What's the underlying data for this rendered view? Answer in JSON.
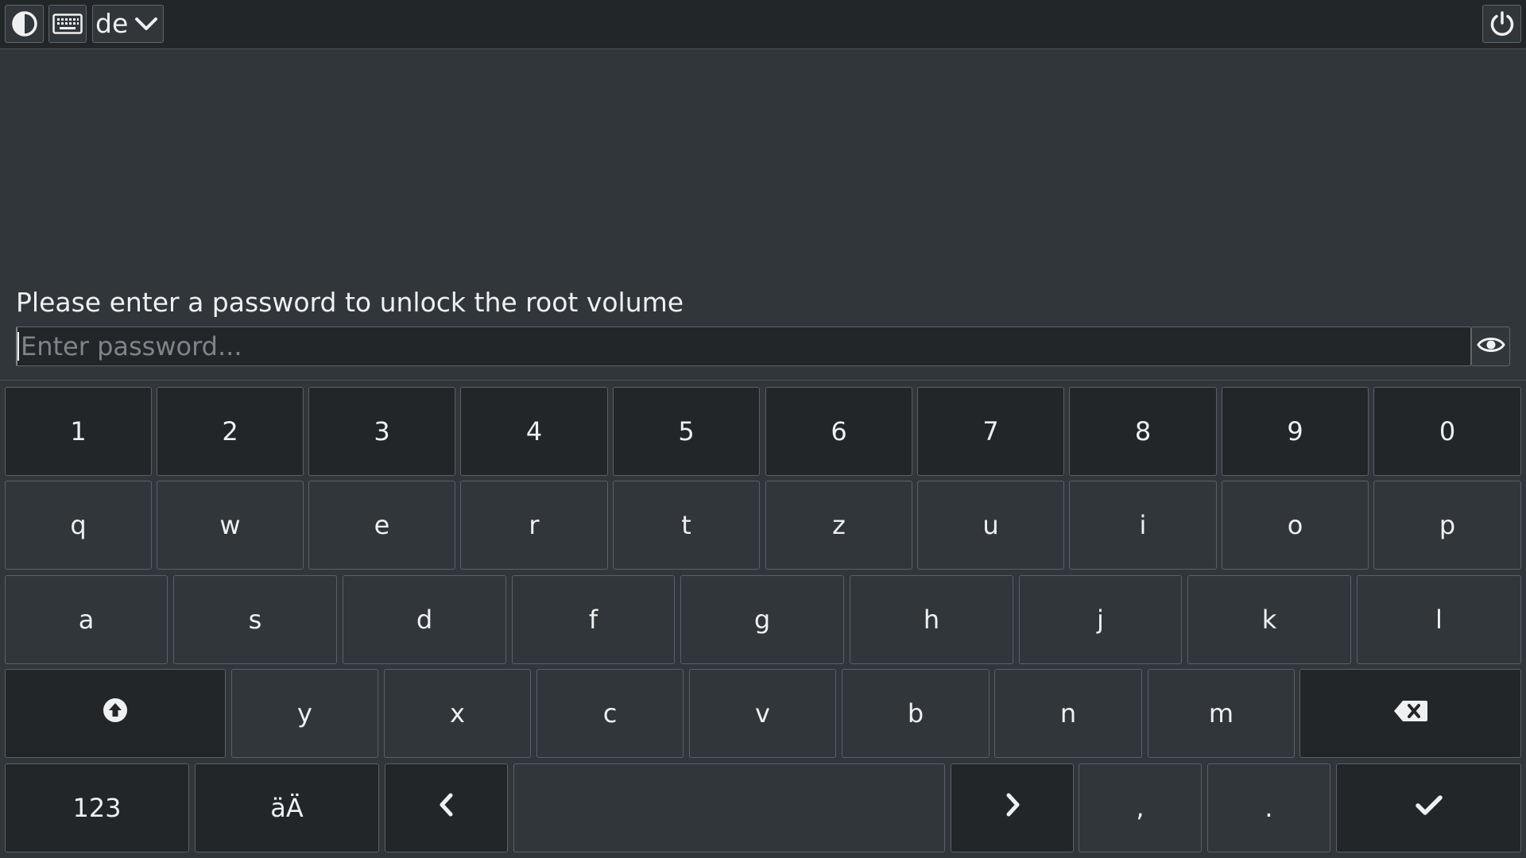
{
  "topbar": {
    "language": "de"
  },
  "prompt": {
    "text": "Please enter a password to unlock the root volume",
    "placeholder": "Enter password...",
    "value": ""
  },
  "keyboard": {
    "row1": [
      "1",
      "2",
      "3",
      "4",
      "5",
      "6",
      "7",
      "8",
      "9",
      "0"
    ],
    "row2": [
      "q",
      "w",
      "e",
      "r",
      "t",
      "z",
      "u",
      "i",
      "o",
      "p"
    ],
    "row3": [
      "a",
      "s",
      "d",
      "f",
      "g",
      "h",
      "j",
      "k",
      "l"
    ],
    "row4": [
      "y",
      "x",
      "c",
      "v",
      "b",
      "n",
      "m"
    ],
    "row5": {
      "numbers_label": "123",
      "umlaut_label": "äÄ",
      "comma_label": ",",
      "period_label": "."
    }
  },
  "icons": {
    "contrast": "contrast-icon",
    "keyboard": "keyboard-icon",
    "dropdown": "chevron-down-icon",
    "power": "power-icon",
    "reveal": "eye-icon",
    "shift": "shift-arrow-up-icon",
    "backspace": "backspace-icon",
    "left": "chevron-left-icon",
    "right": "chevron-right-icon",
    "enter": "checkmark-icon"
  },
  "colors": {
    "topbar_bg": "#232629",
    "background": "#31363b",
    "key_bg": "#232629",
    "key_alt_bg": "#31363b",
    "text": "#eff0f1",
    "placeholder": "#7f8489"
  }
}
